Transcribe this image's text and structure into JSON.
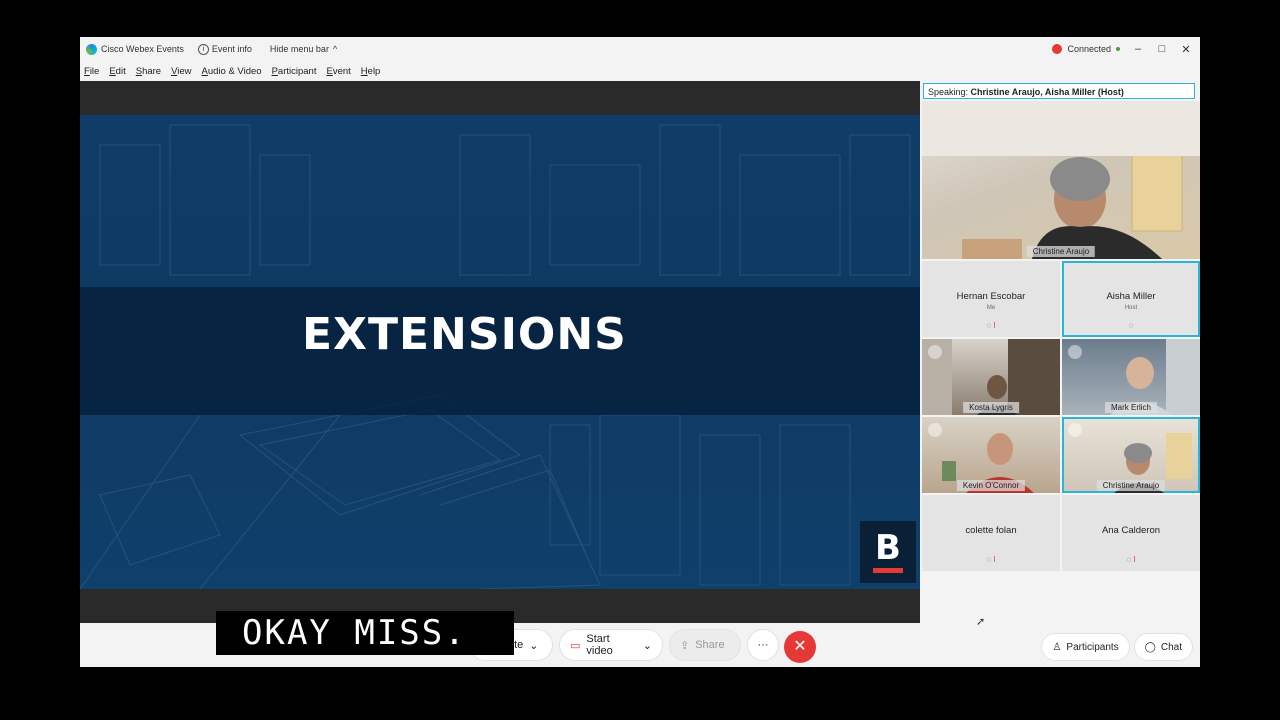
{
  "window": {
    "app_title": "Cisco Webex Events",
    "event_info": "Event info",
    "hide_menu": "Hide menu bar",
    "status": "Connected"
  },
  "menu": [
    "File",
    "Edit",
    "Share",
    "View",
    "Audio & Video",
    "Participant",
    "Event",
    "Help"
  ],
  "slide": {
    "title": "EXTENSIONS",
    "badge_letter": "B"
  },
  "caption": "OKAY MISS.",
  "controls": {
    "mute": "ute",
    "start_video": "Start video",
    "share": "Share",
    "more": "···",
    "end": "✕"
  },
  "panel": {
    "speaking_label": "Speaking:",
    "speaking_names": "Christine Araujo, Aisha Miller (Host)",
    "main_speaker": "Christine Araujo",
    "participants_btn": "Participants",
    "chat_btn": "Chat"
  },
  "tiles": [
    {
      "name": "Hernan Escobar",
      "sub": "Me"
    },
    {
      "name": "Aisha Miller",
      "sub": "Host"
    },
    {
      "name": "Kosta Lygris"
    },
    {
      "name": "Mark Erlich"
    },
    {
      "name": "Kevin O'Connor"
    },
    {
      "name": "Christine Araujo"
    },
    {
      "name": "colette folan"
    },
    {
      "name": "Ana Calderon"
    }
  ],
  "colors": {
    "accent": "#29b6d6",
    "end_call": "#e53935",
    "slide_bg": "#0f3d67"
  }
}
